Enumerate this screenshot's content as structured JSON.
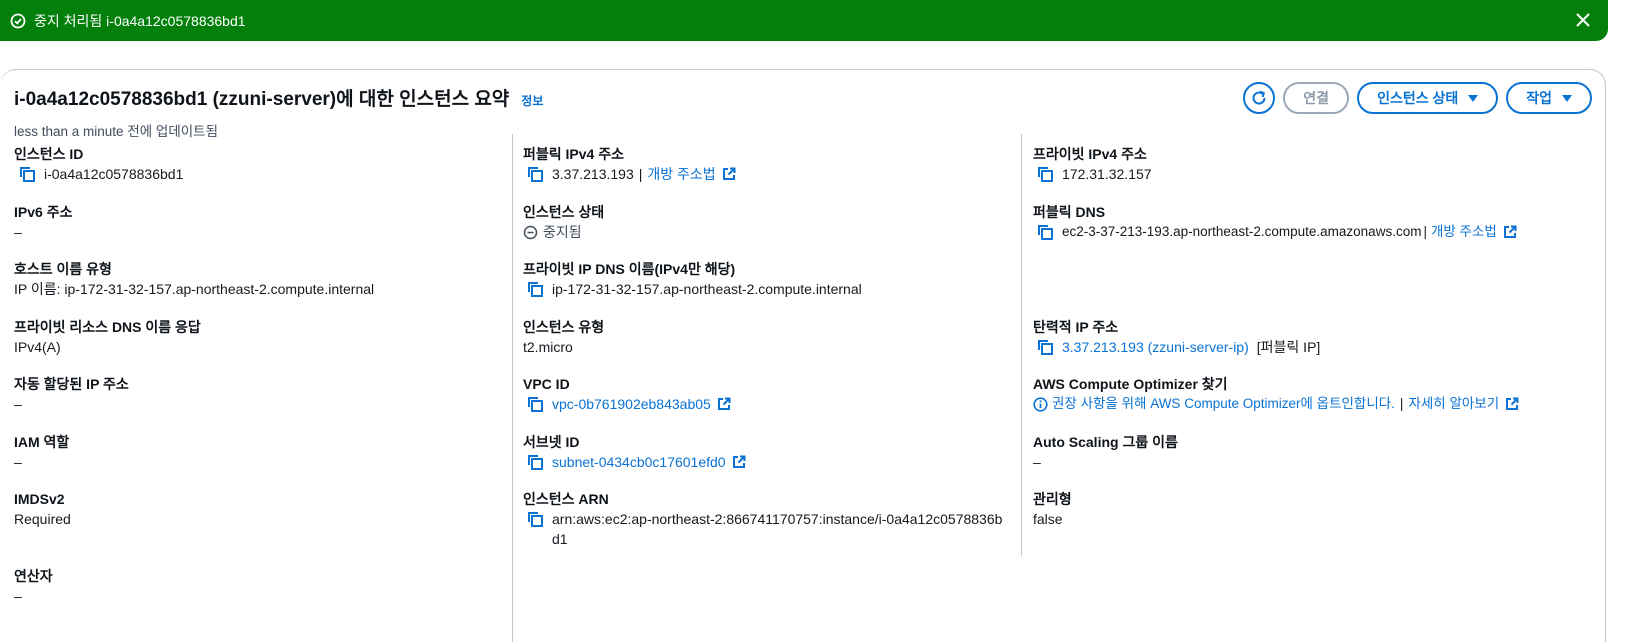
{
  "flash": {
    "message": "중지 처리됨 i-0a4a12c0578836bd1"
  },
  "header": {
    "title": "i-0a4a12c0578836bd1 (zzuni-server)에 대한 인스턴스 요약",
    "info": "정보",
    "updated": "less than a minute 전에 업데이트됨"
  },
  "actions": {
    "connect": "연결",
    "instance_state": "인스턴스 상태",
    "actions": "작업"
  },
  "col1": {
    "instance_id_label": "인스턴스 ID",
    "instance_id": "i-0a4a12c0578836bd1",
    "ipv6_label": "IPv6 주소",
    "ipv6": "–",
    "hostname_type_label": "호스트 이름 유형",
    "hostname_type": "IP 이름: ip-172-31-32-157.ap-northeast-2.compute.internal",
    "private_dns_resp_label": "프라이빗 리소스 DNS 이름 응답",
    "private_dns_resp": "IPv4(A)",
    "auto_ip_label": "자동 할당된 IP 주소",
    "auto_ip": "–",
    "iam_label": "IAM 역할",
    "iam": "–",
    "imds_label": "IMDSv2",
    "imds": "Required",
    "operator_label": "연산자",
    "operator": "–"
  },
  "col2": {
    "public_ipv4_label": "퍼블릭 IPv4 주소",
    "public_ipv4": "3.37.213.193",
    "open_address": "개방 주소법",
    "state_label": "인스턴스 상태",
    "state": "중지됨",
    "private_dns_label": "프라이빗 IP DNS 이름(IPv4만 해당)",
    "private_dns": "ip-172-31-32-157.ap-northeast-2.compute.internal",
    "type_label": "인스턴스 유형",
    "type": "t2.micro",
    "vpc_label": "VPC ID",
    "vpc": "vpc-0b761902eb843ab05",
    "subnet_label": "서브넷 ID",
    "subnet": "subnet-0434cb0c17601efd0",
    "arn_label": "인스턴스 ARN",
    "arn": "arn:aws:ec2:ap-northeast-2:866741170757:instance/i-0a4a12c0578836bd1"
  },
  "col3": {
    "private_ipv4_label": "프라이빗 IPv4 주소",
    "private_ipv4": "172.31.32.157",
    "public_dns_label": "퍼블릭 DNS",
    "public_dns": "ec2-3-37-213-193.ap-northeast-2.compute.amazonaws.com",
    "open_address": "개방 주소법",
    "eip_label": "탄력적 IP 주소",
    "eip": "3.37.213.193 (zzuni-server-ip)",
    "eip_suffix": "[퍼블릭 IP]",
    "optimizer_label": "AWS Compute Optimizer 찾기",
    "optimizer_text": "권장 사항을 위해 AWS Compute Optimizer에 옵트인합니다.",
    "learn_more": "자세히 알아보기",
    "asg_label": "Auto Scaling 그룹 이름",
    "asg": "–",
    "managed_label": "관리형",
    "managed": "false"
  },
  "colors": {
    "success": "#037f0c",
    "link": "#0972d3",
    "text": "#16191f"
  }
}
